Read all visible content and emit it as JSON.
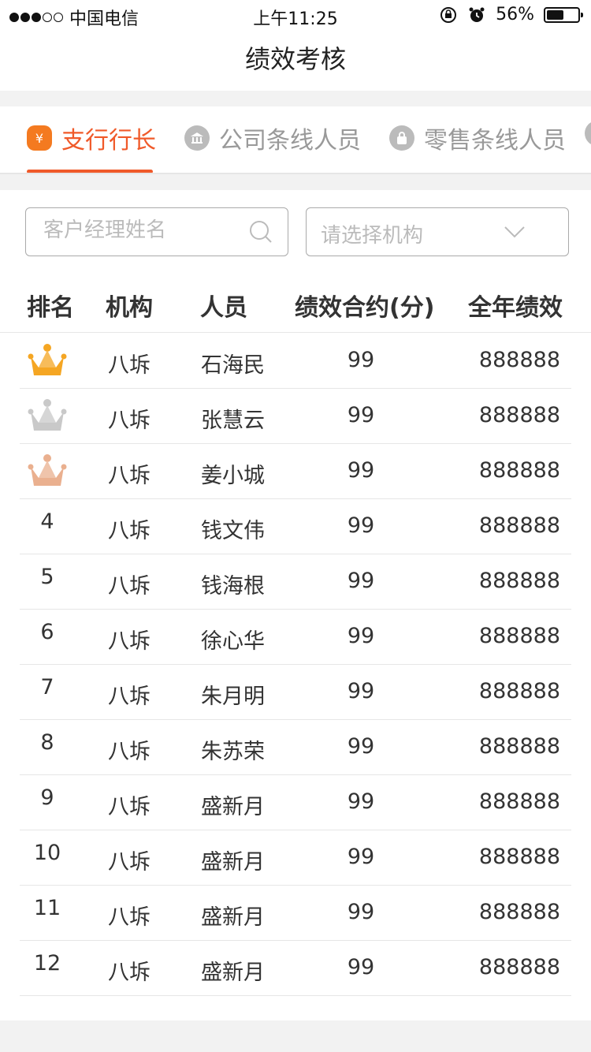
{
  "status_bar": {
    "carrier": "中国电信",
    "time": "上午11:25",
    "battery_percent": "56%",
    "battery_level": 0.56,
    "signal_dots": [
      true,
      true,
      true,
      false,
      false
    ]
  },
  "header": {
    "title": "绩效考核"
  },
  "tabs": [
    {
      "label": "支行行长",
      "icon": "yuan-icon",
      "active": true
    },
    {
      "label": "公司条线人员",
      "icon": "bank-icon",
      "active": false
    },
    {
      "label": "零售条线人员",
      "icon": "bag-icon",
      "active": false
    }
  ],
  "filters": {
    "name_placeholder": "客户经理姓名",
    "org_placeholder": "请选择机构"
  },
  "table": {
    "columns": [
      "排名",
      "机构",
      "人员",
      "绩效合约(分)",
      "全年绩效"
    ],
    "rows": [
      {
        "rank": "1",
        "medal": "gold-crown-icon",
        "org": "八坼",
        "name": "石海民",
        "score": "99",
        "annual": "888888"
      },
      {
        "rank": "2",
        "medal": "silver-crown-icon",
        "org": "八坼",
        "name": "张慧云",
        "score": "99",
        "annual": "888888"
      },
      {
        "rank": "3",
        "medal": "bronze-crown-icon",
        "org": "八坼",
        "name": "姜小城",
        "score": "99",
        "annual": "888888"
      },
      {
        "rank": "4",
        "org": "八坼",
        "name": "钱文伟",
        "score": "99",
        "annual": "888888"
      },
      {
        "rank": "5",
        "org": "八坼",
        "name": "钱海根",
        "score": "99",
        "annual": "888888"
      },
      {
        "rank": "6",
        "org": "八坼",
        "name": "徐心华",
        "score": "99",
        "annual": "888888"
      },
      {
        "rank": "7",
        "org": "八坼",
        "name": "朱月明",
        "score": "99",
        "annual": "888888"
      },
      {
        "rank": "8",
        "org": "八坼",
        "name": "朱苏荣",
        "score": "99",
        "annual": "888888"
      },
      {
        "rank": "9",
        "org": "八坼",
        "name": "盛新月",
        "score": "99",
        "annual": "888888"
      },
      {
        "rank": "10",
        "org": "八坼",
        "name": "盛新月",
        "score": "99",
        "annual": "888888"
      },
      {
        "rank": "11",
        "org": "八坼",
        "name": "盛新月",
        "score": "99",
        "annual": "888888"
      },
      {
        "rank": "12",
        "org": "八坼",
        "name": "盛新月",
        "score": "99",
        "annual": "888888"
      }
    ]
  },
  "colors": {
    "accent": "#f05a2a",
    "gold": "#f5a623",
    "silver": "#c9c9c9",
    "bronze": "#eab08f"
  }
}
